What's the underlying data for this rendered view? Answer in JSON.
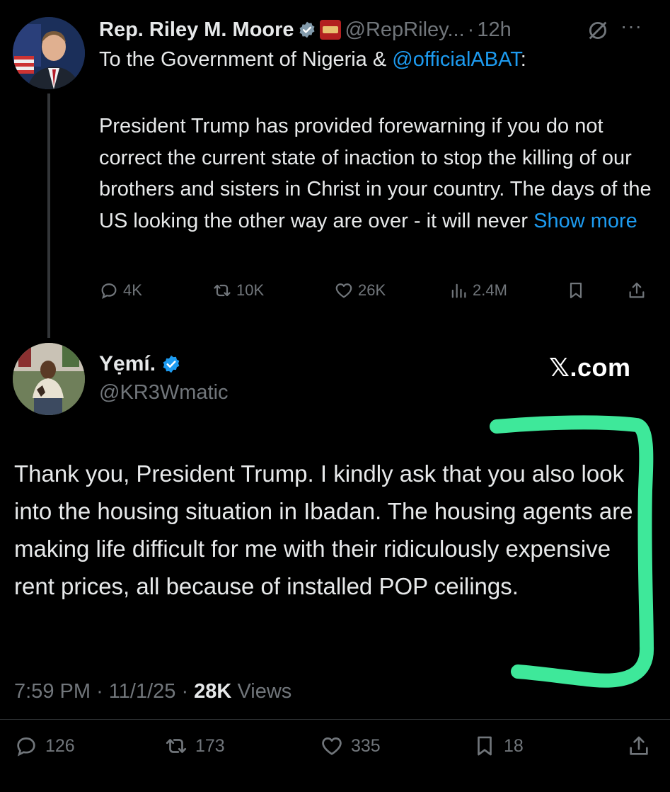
{
  "parent_tweet": {
    "author_name": "Rep. Riley M. Moore",
    "handle": "@RepRiley...",
    "separator": "·",
    "time": "12h",
    "reply_prefix": "To the Government of Nigeria & ",
    "mention": "@officialABAT",
    "reply_suffix": ":",
    "body": "President Trump has provided forewarning if you do not correct the current state of inaction to stop the killing of our brothers and sisters in Christ in your country. The days of the US looking the other way are over - it will never ",
    "show_more": "Show more",
    "stats": {
      "replies": "4K",
      "reposts": "10K",
      "likes": "26K",
      "views": "2.4M"
    },
    "icons": [
      "verified-badge-icon",
      "flag-icon",
      "grok-icon",
      "more-icon",
      "reply-icon",
      "repost-icon",
      "like-icon",
      "views-icon",
      "bookmark-icon",
      "share-icon"
    ]
  },
  "reply_tweet": {
    "author_name": "Yẹmí.",
    "handle": "@KR3Wmatic",
    "watermark": "𝕏.com",
    "body": "Thank you, President Trump. I kindly ask that you also look into the housing situation in Ibadan. The housing agents are making life difficult for me with their ridiculously expensive rent prices, all because of installed POP ceilings.",
    "time": "7:59 PM",
    "date": "11/1/25",
    "views_count": "28K",
    "views_label": "Views",
    "stats": {
      "replies": "126",
      "reposts": "173",
      "likes": "335",
      "bookmarks": "18"
    }
  },
  "colors": {
    "background": "#000000",
    "text": "#e7e9ea",
    "muted": "#71767b",
    "link": "#1d9bf0",
    "annotation_bracket": "#3ee89a"
  }
}
